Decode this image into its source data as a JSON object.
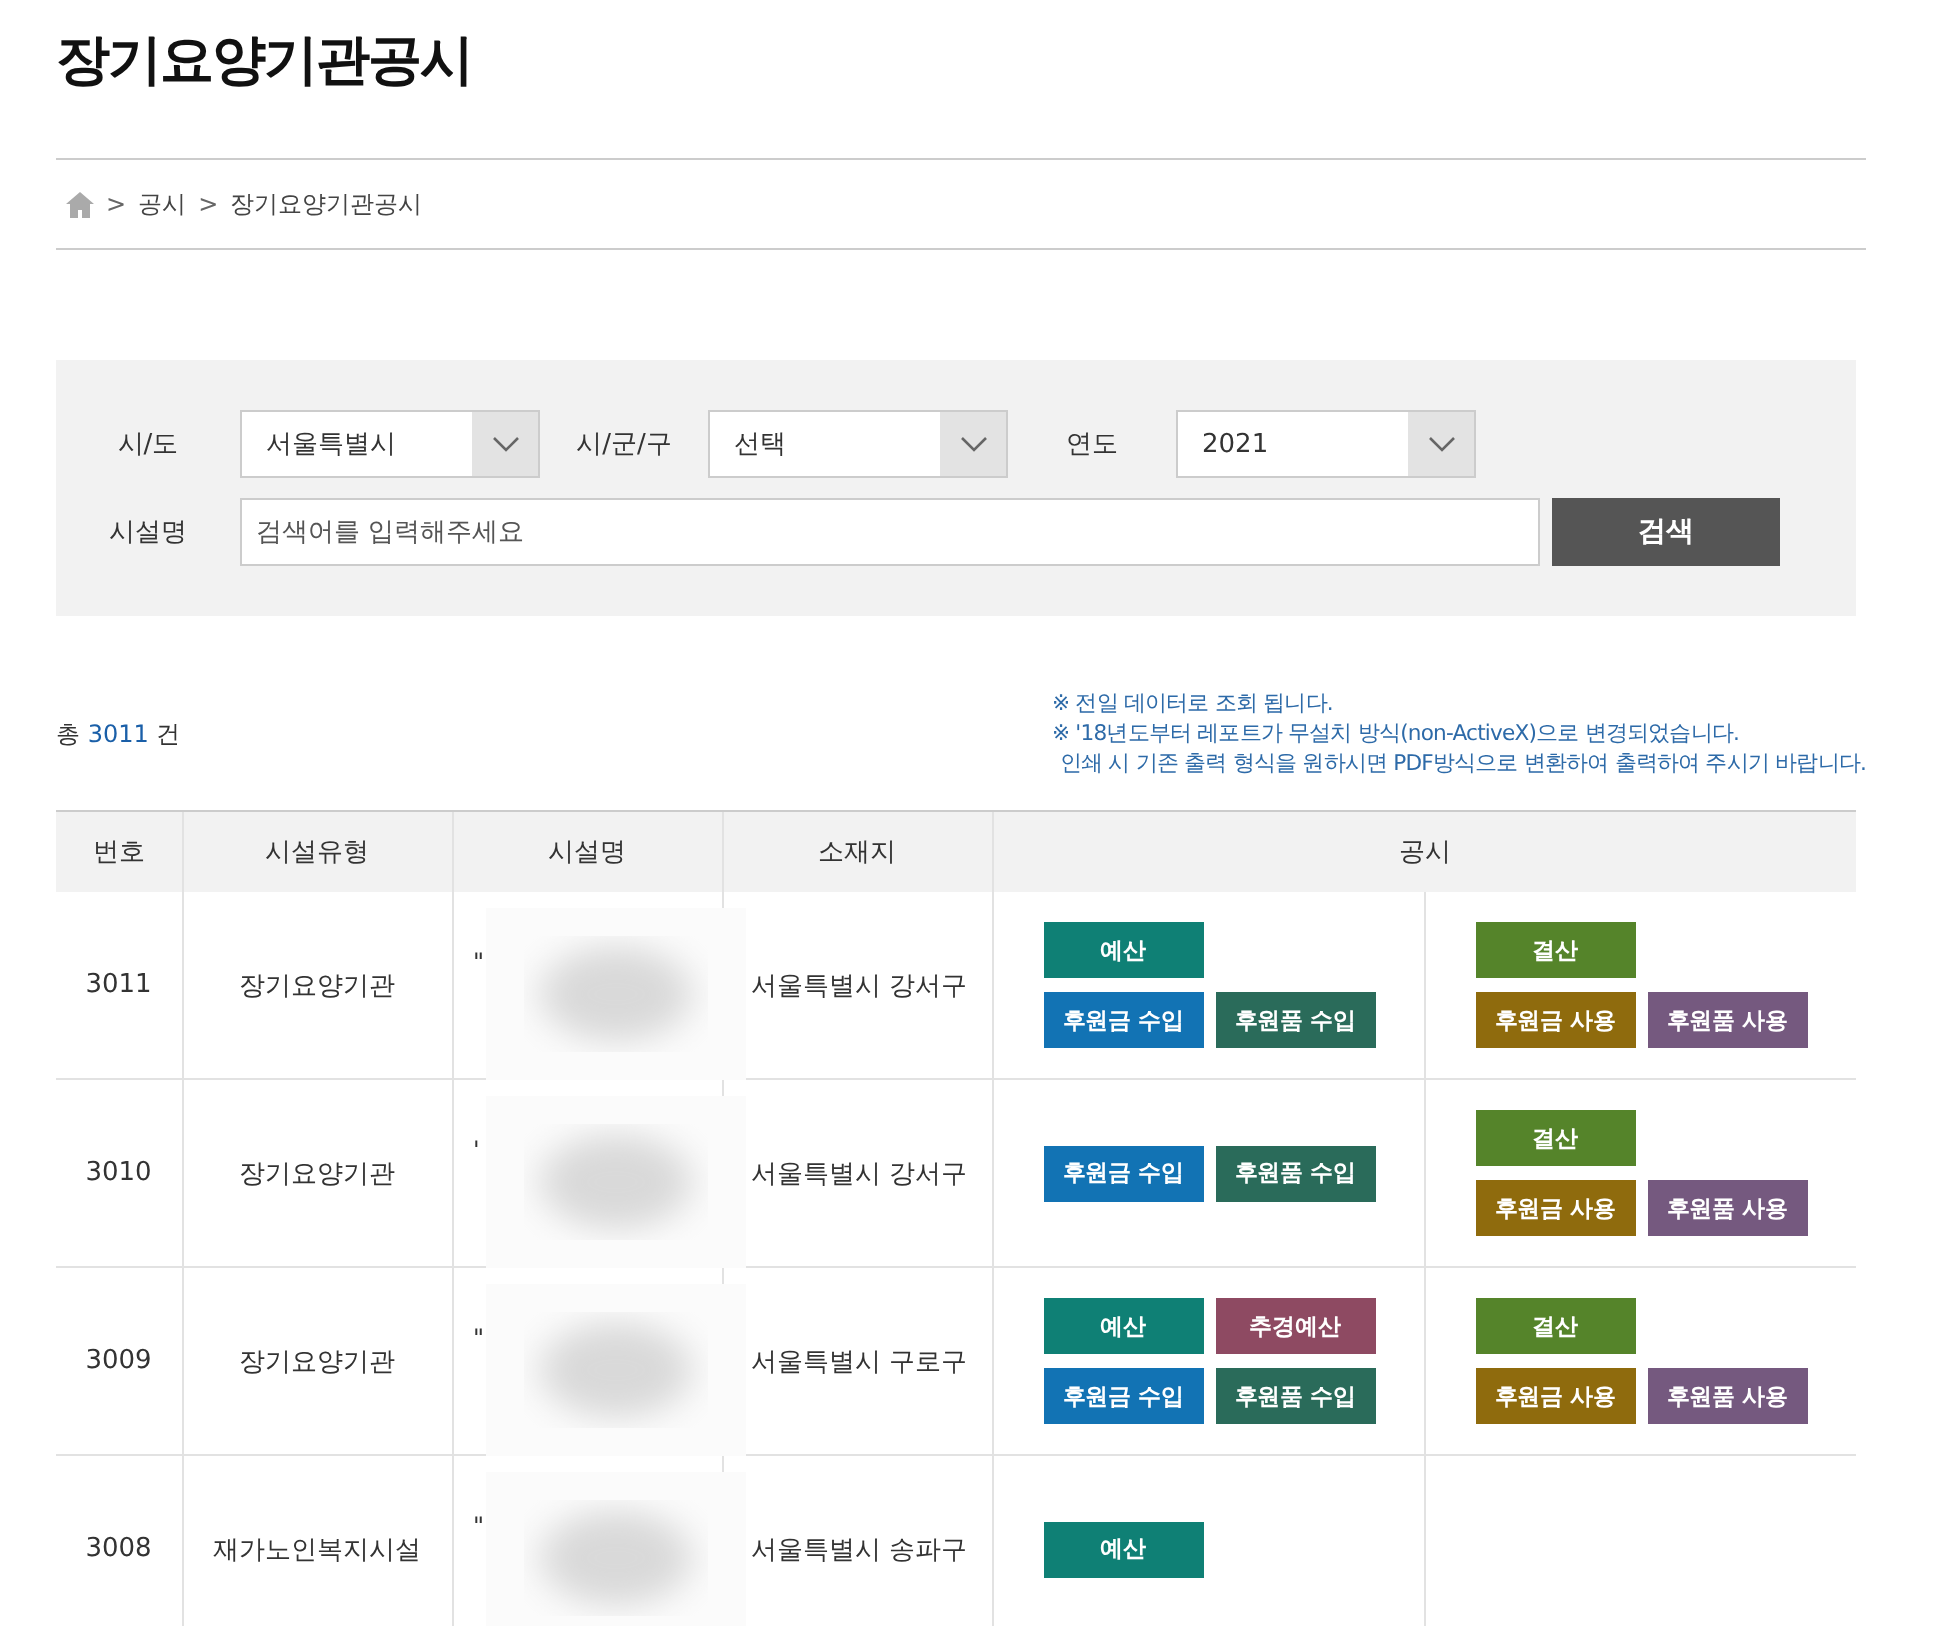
{
  "page_title": "장기요양기관공시",
  "breadcrumb": [
    "공시",
    "장기요양기관공시"
  ],
  "breadcrumb_separator": ">",
  "search": {
    "fields": [
      {
        "label": "시/도",
        "kind": "select",
        "value": "서울특별시"
      },
      {
        "label": "시/군/구",
        "kind": "select",
        "value": "선택"
      },
      {
        "label": "연도",
        "kind": "select",
        "value": "2021"
      }
    ],
    "name_label": "시설명",
    "name_placeholder": "검색어를 입력해주세요",
    "button": "검색"
  },
  "total": {
    "prefix": "총",
    "count": "3011",
    "suffix": "건"
  },
  "notes": [
    "※ 전일 데이터로 조회 됩니다.",
    "※ '18년도부터 레포트가 무설치 방식(non-ActiveX)으로 변경되었습니다.",
    "인쇄 시 기존 출력 형식을 원하시면 PDF방식으로 변환하여 출력하여 주시기 바랍니다."
  ],
  "table": {
    "columns": [
      "번호",
      "시설유형",
      "시설명",
      "소재지",
      "공시"
    ],
    "rows": [
      {
        "no": "3011",
        "type": "장기요양기관",
        "name_visible": "\"'",
        "location": "서울특별시 강서구",
        "left": [
          [
            {
              "kind": "budget",
              "label": "예산"
            }
          ],
          [
            {
              "kind": "donation_income",
              "label": "후원금 수입"
            },
            {
              "kind": "goods_income",
              "label": "후원품 수입"
            }
          ]
        ],
        "right": [
          [
            {
              "kind": "settlement",
              "label": "결산"
            }
          ],
          [
            {
              "kind": "donation_use",
              "label": "후원금 사용"
            },
            {
              "kind": "goods_use",
              "label": "후원품 사용"
            }
          ]
        ]
      },
      {
        "no": "3010",
        "type": "장기요양기관",
        "name_visible": "'",
        "location": "서울특별시 강서구",
        "left": [
          [
            {
              "kind": "donation_income",
              "label": "후원금 수입"
            },
            {
              "kind": "goods_income",
              "label": "후원품 수입"
            }
          ]
        ],
        "right": [
          [
            {
              "kind": "settlement",
              "label": "결산"
            }
          ],
          [
            {
              "kind": "donation_use",
              "label": "후원금 사용"
            },
            {
              "kind": "goods_use",
              "label": "후원품 사용"
            }
          ]
        ]
      },
      {
        "no": "3009",
        "type": "장기요양기관",
        "name_visible": "\"",
        "location": "서울특별시 구로구",
        "left": [
          [
            {
              "kind": "budget",
              "label": "예산"
            },
            {
              "kind": "extra_budget",
              "label": "추경예산"
            }
          ],
          [
            {
              "kind": "donation_income",
              "label": "후원금 수입"
            },
            {
              "kind": "goods_income",
              "label": "후원품 수입"
            }
          ]
        ],
        "right": [
          [
            {
              "kind": "settlement",
              "label": "결산"
            }
          ],
          [
            {
              "kind": "donation_use",
              "label": "후원금 사용"
            },
            {
              "kind": "goods_use",
              "label": "후원품 사용"
            }
          ]
        ]
      },
      {
        "no": "3008",
        "type": "재가노인복지시설",
        "name_visible": "\"",
        "location": "서울특별시 송파구",
        "left": [
          [
            {
              "kind": "budget",
              "label": "예산"
            }
          ]
        ],
        "right": []
      }
    ]
  }
}
